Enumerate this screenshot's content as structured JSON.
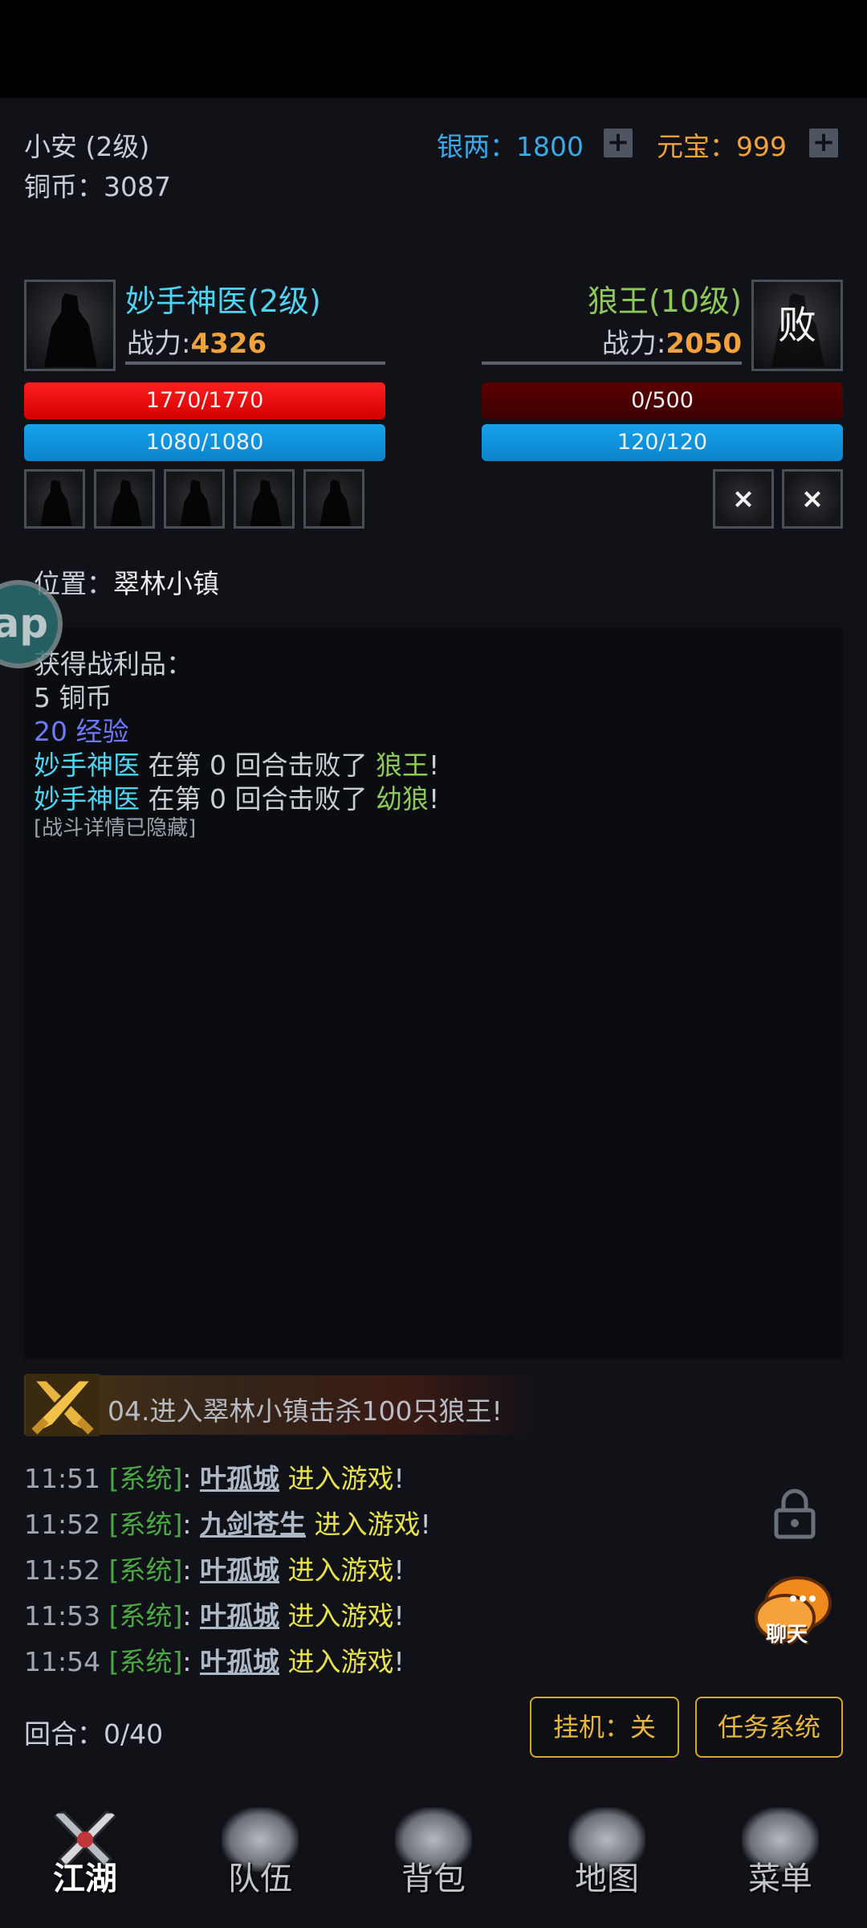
{
  "player": {
    "name": "小安 (2级)",
    "copper_label": "铜币：",
    "copper": "3087"
  },
  "currency": {
    "silver_label": "银两：",
    "silver": "1800",
    "ingot_label": "元宝：",
    "ingot": "999",
    "plus": "+"
  },
  "battle": {
    "ally": {
      "name": "妙手神医(2级)",
      "power_label": "战力:",
      "power": "4326",
      "hp": "1770/1770",
      "mp": "1080/1080",
      "hp_fill": 1.0,
      "mp_fill": 1.0
    },
    "enemy": {
      "name": "狼王(10级)",
      "power_label": "战力:",
      "power": "2050",
      "hp": "0/500",
      "mp": "120/120",
      "status": "败",
      "hp_fill": 0.0,
      "mp_fill": 1.0
    },
    "enemy_slot_mark": "×"
  },
  "location": {
    "label": "位置：",
    "value": "翠林小镇"
  },
  "log": {
    "loot_title": "获得战利品：",
    "loot_copper": "5 铜币",
    "loot_exp": "20 经验",
    "lines": [
      {
        "actor": "妙手神医",
        "mid": " 在第 0 回合击败了 ",
        "target": "狼王",
        "end": "!"
      },
      {
        "actor": "妙手神医",
        "mid": " 在第 0 回合击败了 ",
        "target": "幼狼",
        "end": "!"
      }
    ],
    "hidden_note": "[战斗详情已隐藏]"
  },
  "float_badge": "ap",
  "quest": {
    "text": "04.进入翠林小镇击杀100只狼王!"
  },
  "chat": [
    {
      "time": "11:51",
      "channel": "[系统]",
      "sep": ":",
      "player": "叶孤城",
      "msg": " 进入游戏",
      "end": "!"
    },
    {
      "time": "11:52",
      "channel": "[系统]",
      "sep": ":",
      "player": "九剑苍生",
      "msg": " 进入游戏",
      "end": "!"
    },
    {
      "time": "11:52",
      "channel": "[系统]",
      "sep": ":",
      "player": "叶孤城",
      "msg": " 进入游戏",
      "end": "!"
    },
    {
      "time": "11:53",
      "channel": "[系统]",
      "sep": ":",
      "player": "叶孤城",
      "msg": " 进入游戏",
      "end": "!"
    },
    {
      "time": "11:54",
      "channel": "[系统]",
      "sep": ":",
      "player": "叶孤城",
      "msg": " 进入游戏",
      "end": "!"
    }
  ],
  "chat_button": "聊天",
  "round": {
    "label": "回合：",
    "value": "0/40"
  },
  "buttons": {
    "auto": "挂机：关",
    "tasks": "任务系统"
  },
  "nav": [
    {
      "label": "江湖",
      "icon": "crossed-swords-icon",
      "active": true
    },
    {
      "label": "队伍",
      "icon": "banner-icon",
      "active": false
    },
    {
      "label": "背包",
      "icon": "backpack-icon",
      "active": false
    },
    {
      "label": "地图",
      "icon": "drum-map-icon",
      "active": false
    },
    {
      "label": "菜单",
      "icon": "pagoda-icon",
      "active": false
    }
  ],
  "colors": {
    "background": "#101217",
    "hp": "#ff1f1f",
    "mp": "#16a2ea",
    "ally_name": "#4fd3f0",
    "enemy_name": "#8ec85a",
    "power": "#f0a23c",
    "silver": "#3ba8e8",
    "ingot": "#f0a23c",
    "button_border": "#d7a72a"
  }
}
